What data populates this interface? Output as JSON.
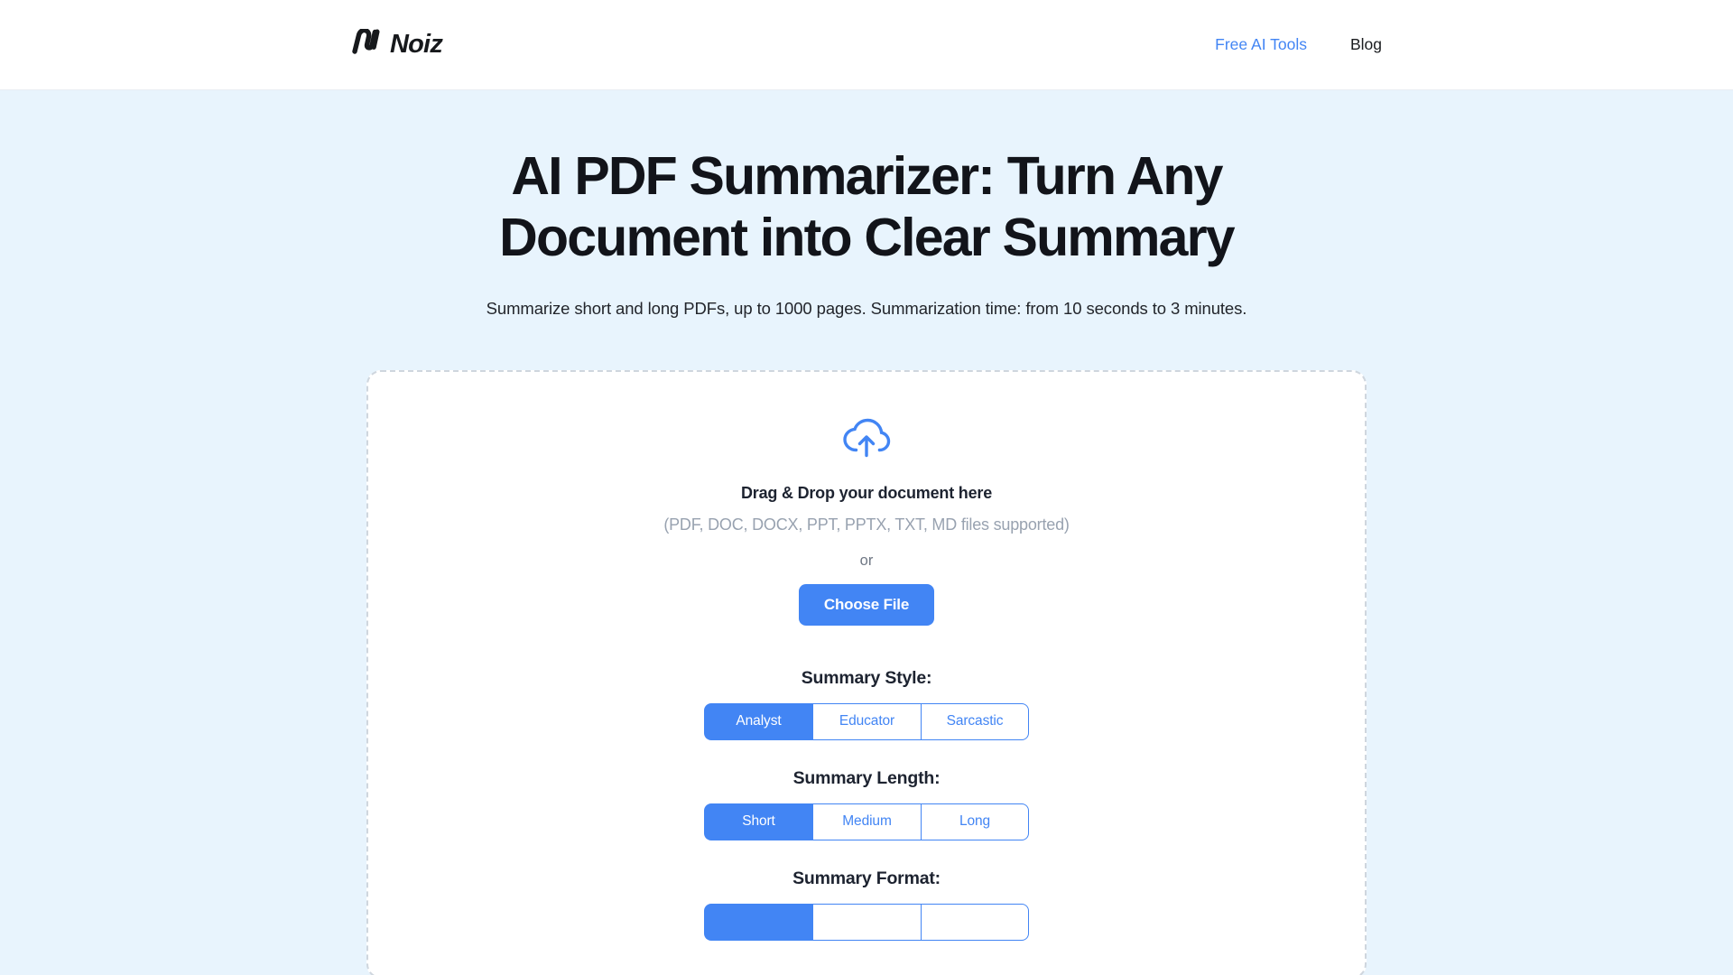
{
  "header": {
    "brand": {
      "name": "Noiz",
      "mark_icon": "noiz-logo-mark"
    },
    "nav": [
      {
        "label": "Free AI Tools",
        "accent": true
      },
      {
        "label": "Blog",
        "accent": false
      }
    ]
  },
  "hero": {
    "title": "AI PDF Summarizer: Turn Any Document into Clear Summary",
    "subtitle": "Summarize short and long PDFs, up to 1000 pages. Summarization time: from 10 seconds to 3 minutes."
  },
  "upload": {
    "icon": "cloud-upload-icon",
    "dropzone_title": "Drag & Drop your document here",
    "formats": "(PDF, DOC, DOCX, PPT, PPTX, TXT, MD files supported)",
    "or": "or",
    "choose_file_label": "Choose File"
  },
  "options": {
    "style": {
      "label": "Summary Style:",
      "segments": [
        {
          "label": "Analyst",
          "selected": true
        },
        {
          "label": "Educator",
          "selected": false
        },
        {
          "label": "Sarcastic",
          "selected": false
        }
      ]
    },
    "length": {
      "label": "Summary Length:",
      "segments": [
        {
          "label": "Short",
          "selected": true
        },
        {
          "label": "Medium",
          "selected": false
        },
        {
          "label": "Long",
          "selected": false
        }
      ]
    },
    "format": {
      "label": "Summary Format:",
      "segments": [
        {
          "label": "",
          "selected": true
        },
        {
          "label": "",
          "selected": false
        },
        {
          "label": "",
          "selected": false
        }
      ]
    }
  },
  "colors": {
    "accent": "#4285f4",
    "hero_background": "#e8f4fd",
    "header_background": "#ffffff",
    "card_background": "#ffffff",
    "card_border": "#cfd6de",
    "heading_text": "#12141a",
    "muted_text": "#98a2b0"
  }
}
